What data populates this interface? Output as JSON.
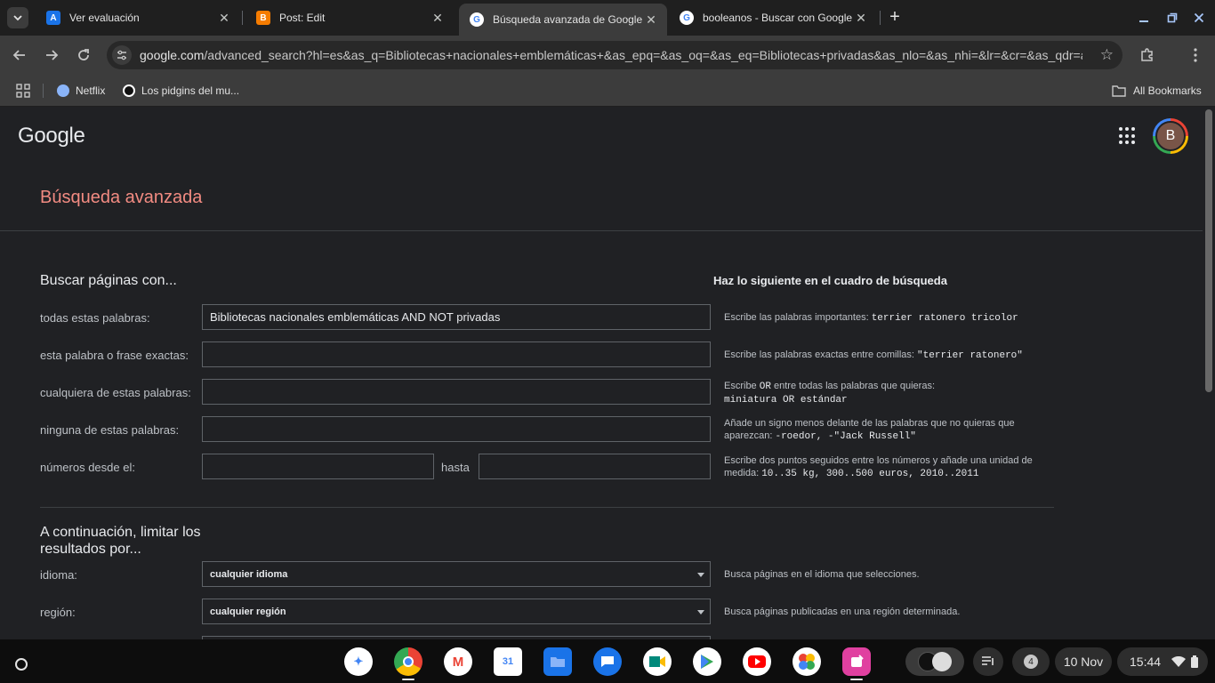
{
  "tabs": [
    {
      "title": "Ver evaluación",
      "favicon": "atlas-icon",
      "color": "#1a73e8"
    },
    {
      "title": "Post: Edit",
      "favicon": "blogger-icon",
      "color": "#f57c00"
    },
    {
      "title": "Búsqueda avanzada de Google",
      "favicon": "google-icon",
      "active": true
    },
    {
      "title": "booleanos - Buscar con Google",
      "favicon": "google-icon"
    }
  ],
  "omnibox": {
    "host": "google.com",
    "path": "/advanced_search?hl=es&as_q=Bibliotecas+nacionales+emblemáticas+&as_epq=&as_oq=&as_eq=Bibliotecas+privadas&as_nlo=&as_nhi=&lr=&cr=&as_qdr=a..."
  },
  "bookmarks": {
    "items": [
      "Netflix",
      "Los pidgins del mu..."
    ],
    "all": "All Bookmarks"
  },
  "page": {
    "logo": "Google",
    "avatar_letter": "B",
    "header_title": "Búsqueda avanzada",
    "section1_title": "Buscar páginas con...",
    "help_header": "Haz lo siguiente en el cuadro de búsqueda",
    "rows": [
      {
        "label": "todas estas palabras:",
        "value": "Bibliotecas nacionales emblemáticas AND NOT privadas",
        "hint_pre": "Escribe las palabras importantes: ",
        "hint_code": "terrier ratonero tricolor"
      },
      {
        "label": "esta palabra o frase exactas:",
        "value": "",
        "hint_pre": "Escribe las palabras exactas entre comillas: ",
        "hint_code": "\"terrier ratonero\""
      },
      {
        "label": "cualquiera de estas palabras:",
        "value": "",
        "hint_pre": "Escribe ",
        "hint_or": "OR",
        "hint_post": " entre todas las palabras que quieras:",
        "hint_code": "miniatura OR estándar"
      },
      {
        "label": "ninguna de estas palabras:",
        "value": "",
        "hint_pre": "Añade un signo menos delante de las palabras que no quieras que aparezcan: ",
        "hint_code": "-roedor, -\"Jack Russell\""
      },
      {
        "label": "números desde el:",
        "value_from": "",
        "hasta": "hasta",
        "value_to": "",
        "hint_pre": "Escribe dos puntos seguidos entre los números y añade una unidad de medida: ",
        "hint_code": "10..35 kg, 300..500 euros, 2010..2011"
      }
    ],
    "section2_title_line1": "A continuación, limitar los",
    "section2_title_line2": "resultados por...",
    "limits": [
      {
        "label": "idioma:",
        "value": "cualquier idioma",
        "hint": "Busca páginas en el idioma que selecciones."
      },
      {
        "label": "región:",
        "value": "cualquier región",
        "hint": "Busca páginas publicadas en una región determinada."
      }
    ]
  },
  "shelf": {
    "apps": [
      "Gemini",
      "Chrome",
      "Gmail",
      "Calendar",
      "Files",
      "Messages",
      "Meet",
      "Play Store",
      "YouTube",
      "Photos",
      "Canva"
    ],
    "notification_count": "4",
    "date": "10 Nov",
    "time": "15:44"
  }
}
